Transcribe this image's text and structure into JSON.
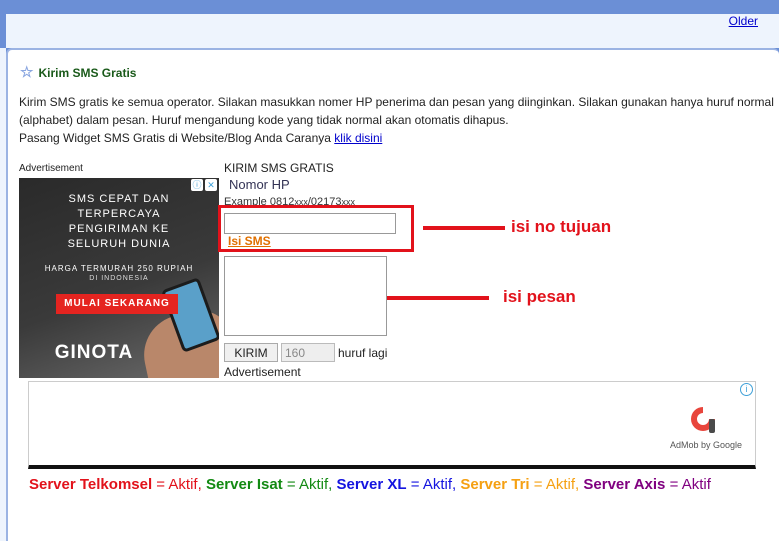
{
  "nav": {
    "older_label": "Older"
  },
  "widget": {
    "title": "Kirim SMS Gratis",
    "description_1": "Kirim SMS gratis ke semua operator. Silakan masukkan nomer HP penerima dan pesan yang diinginkan. Silakan gunakan hanya huruf normal (alphabet) dalam pesan. Huruf mengandung kode yang tidak normal akan otomatis dihapus.",
    "description_2": "Pasang Widget SMS Gratis di Website/Blog Anda Caranya",
    "link_label": "klik disini"
  },
  "ad_left": {
    "label": "Advertisement",
    "headline_lines": [
      "SMS CEPAT DAN",
      "TERPERCAYA",
      "PENGIRIMAN KE",
      "SELURUH DUNIA"
    ],
    "price_text": "HARGA TERMURAH 250 RUPIAH",
    "region_text": "DI INDONESIA",
    "cta": "MULAI SEKARANG",
    "brand": "GINOTA"
  },
  "form": {
    "heading": "KIRIM SMS GRATIS",
    "phone_label": "Nomor HP",
    "example_label": "Example 0812",
    "example_suffix_1": "xxx",
    "example_mid": "/02173",
    "example_suffix_2": "xxx",
    "phone_value": "",
    "message_label": "Isi SMS",
    "message_value": "",
    "send_label": "KIRIM",
    "counter_value": "160",
    "counter_suffix": "huruf lagi",
    "ad2_label": "Advertisement"
  },
  "annotations": {
    "phone_note": "isi no tujuan",
    "message_note": "isi pesan"
  },
  "admob": {
    "label": "AdMob by Google"
  },
  "servers": [
    {
      "name": "Server Telkomsel",
      "status": "Aktif",
      "color": "#e2121b"
    },
    {
      "name": "Server Isat",
      "status": "Aktif",
      "color": "#138a13"
    },
    {
      "name": "Server XL",
      "status": "Aktif",
      "color": "#1414e0"
    },
    {
      "name": "Server Tri",
      "status": "Aktif",
      "color": "#f5a012"
    },
    {
      "name": "Server Axis",
      "status": "Aktif",
      "color": "#800080"
    }
  ],
  "colors": {
    "accent": "#e2121b",
    "frame": "#6b8fd6",
    "link": "#0000cc"
  }
}
